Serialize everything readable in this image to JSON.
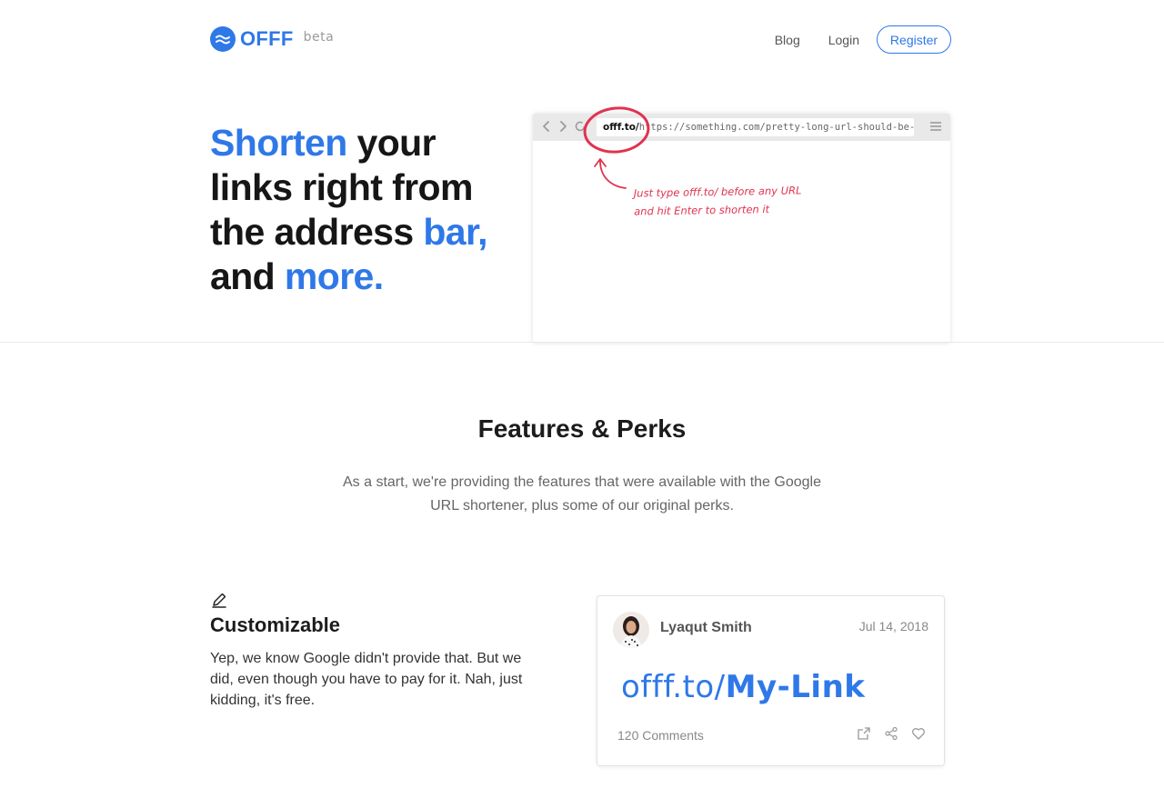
{
  "nav": {
    "logo_text": "OFFF",
    "logo_badge": "beta",
    "links": {
      "blog": "Blog",
      "login": "Login"
    },
    "register_label": "Register"
  },
  "hero": {
    "title_parts": {
      "p1": "Shorten",
      "p2": " your links right from the address ",
      "p3": "bar,",
      "p4": " and ",
      "p5": "more."
    },
    "browser": {
      "url_prefix": "offf.to/",
      "url_rest": "https://something.com/pretty-long-url-should-be-shortened",
      "annotation_line1": "Just type offf.to/ before any URL",
      "annotation_line2": "and hit Enter to shorten it",
      "annotation_color": "#e0334f"
    }
  },
  "features": {
    "title": "Features & Perks",
    "description": "As a start, we're providing the features that were available with the Google URL shortener, plus some of our original perks.",
    "items": [
      {
        "icon": "pencil-icon",
        "title": "Customizable",
        "description": "Yep, we know Google didn't provide that. But we did, even though you have to pay for it. Nah, just kidding, it's free."
      }
    ],
    "card": {
      "author": "Lyaqut Smith",
      "date": "Jul 14, 2018",
      "link_domain": "offf.to/",
      "link_slug": "My-Link",
      "comments": "120 Comments",
      "actions": [
        "share-out-icon",
        "share-icon",
        "heart-icon"
      ]
    }
  },
  "colors": {
    "accent": "#2f78e8",
    "annotation": "#e0334f"
  }
}
